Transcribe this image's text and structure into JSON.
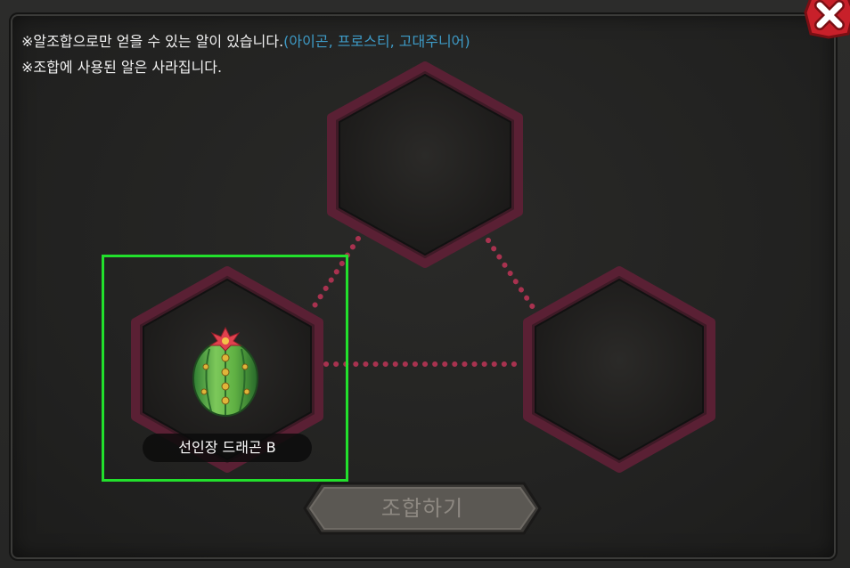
{
  "notices": {
    "line1_prefix": "※알조합으로만 얻을 수 있는 알이 있습니다.",
    "line1_highlight": "(아이곤, 프로스티, 고대주니어)",
    "line2": "※조합에 사용된 알은 사라집니다."
  },
  "slots": [
    {
      "position": "top",
      "item": null
    },
    {
      "position": "left",
      "item": {
        "name": "선인장 드래곤 B",
        "icon": "cactus-egg-icon"
      }
    },
    {
      "position": "right",
      "item": null
    }
  ],
  "combine_button": {
    "label": "조합하기",
    "enabled": false
  },
  "close_button": {
    "icon": "close-x-icon"
  },
  "colors": {
    "highlight": "#3e9bc7",
    "connector": "#a8324f",
    "slot_border": "#5a2034",
    "selection": "#22e02c",
    "close_red": "#c8202a"
  }
}
